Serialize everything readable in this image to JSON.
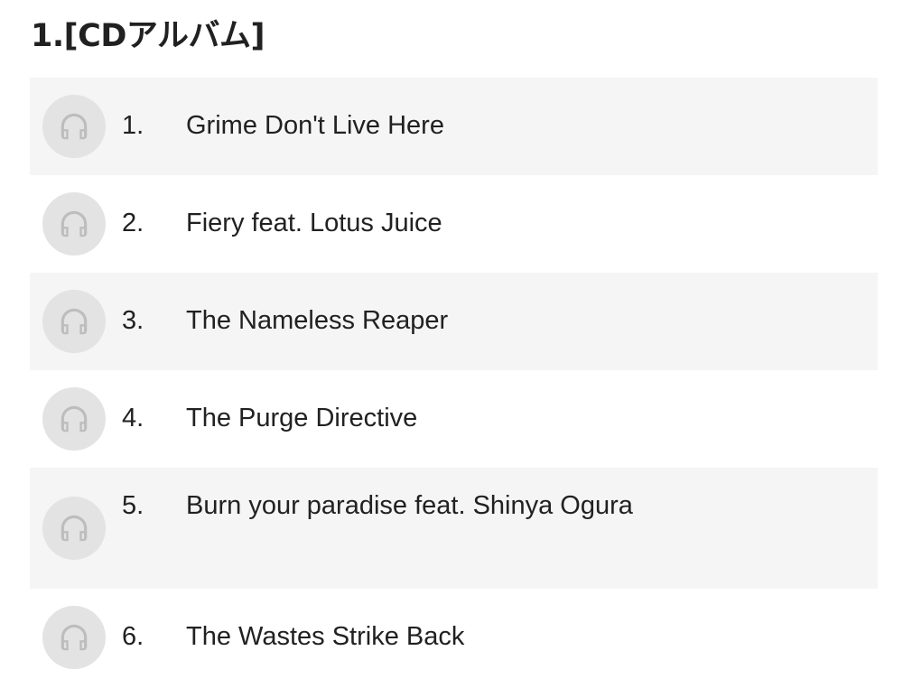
{
  "section": {
    "heading": "1.[CDアルバム]"
  },
  "colors": {
    "row_shaded": "#f5f5f5",
    "row_plain": "#ffffff",
    "play_button_bg": "#e3e3e3",
    "icon_color": "#bdbdbd",
    "text": "#212121"
  },
  "tracks": [
    {
      "number": "1.",
      "title": "Grime Don't Live Here",
      "icon": "headphones-icon"
    },
    {
      "number": "2.",
      "title": "Fiery feat. Lotus Juice",
      "icon": "headphones-icon"
    },
    {
      "number": "3.",
      "title": "The Nameless Reaper",
      "icon": "headphones-icon"
    },
    {
      "number": "4.",
      "title": "The Purge Directive",
      "icon": "headphones-icon"
    },
    {
      "number": "5.",
      "title": "Burn your paradise feat. Shinya Ogura",
      "icon": "headphones-icon"
    },
    {
      "number": "6.",
      "title": "The Wastes Strike Back",
      "icon": "headphones-icon"
    }
  ]
}
